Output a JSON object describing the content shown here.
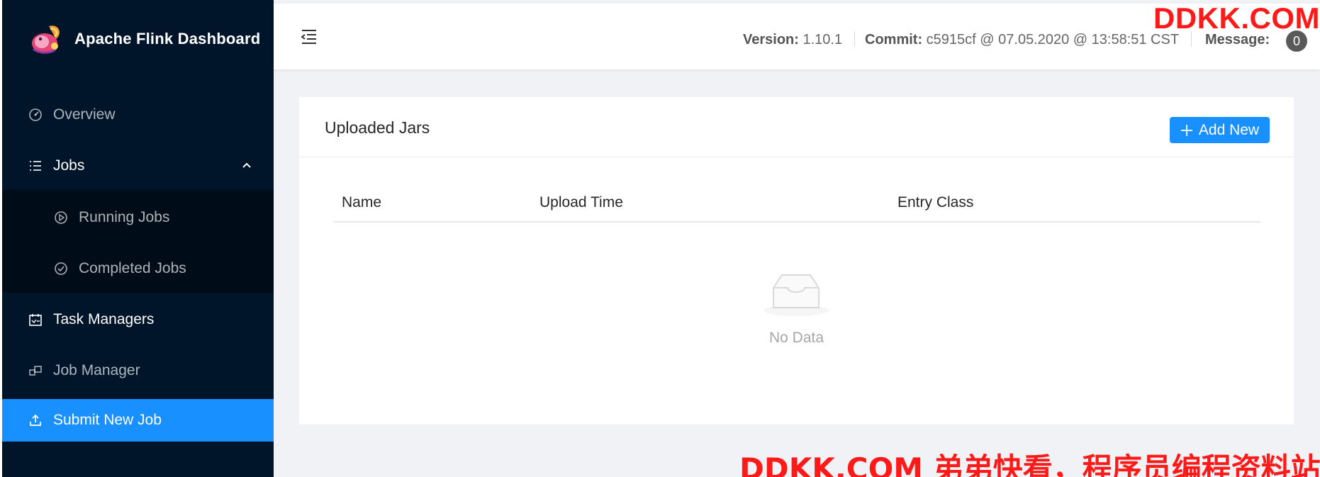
{
  "app": {
    "title": "Apache Flink Dashboard"
  },
  "sidebar": {
    "items": [
      {
        "label": "Overview",
        "icon": "dashboard-icon"
      },
      {
        "label": "Jobs",
        "icon": "list-icon",
        "expanded": true
      },
      {
        "label": "Running Jobs",
        "icon": "play-circle-icon"
      },
      {
        "label": "Completed Jobs",
        "icon": "check-circle-icon"
      },
      {
        "label": "Task Managers",
        "icon": "schedule-icon"
      },
      {
        "label": "Job Manager",
        "icon": "block-icon"
      },
      {
        "label": "Submit New Job",
        "icon": "upload-icon",
        "active": true
      }
    ]
  },
  "header": {
    "version_label": "Version:",
    "version_value": "1.10.1",
    "commit_label": "Commit:",
    "commit_value": "c5915cf @ 07.05.2020 @ 13:58:51 CST",
    "message_label": "Message:",
    "message_count": "0"
  },
  "watermark": {
    "top": "DDKK.COM",
    "bottom": "DDKK.COM 弟弟快看，程序员编程资料站"
  },
  "card": {
    "title": "Uploaded Jars",
    "add_button": "Add New",
    "columns": [
      "Name",
      "Upload Time",
      "Entry Class"
    ],
    "empty_text": "No Data"
  },
  "colors": {
    "sidebar_bg": "#001529",
    "submenu_bg": "#000c17",
    "accent": "#1890ff",
    "watermark": "#ff1a1a"
  }
}
